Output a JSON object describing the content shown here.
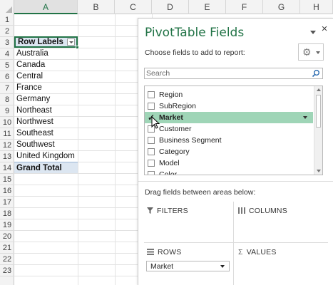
{
  "sheet": {
    "columns": [
      "A",
      "B",
      "C",
      "D",
      "E",
      "F",
      "G",
      "H"
    ],
    "selected_column": "A",
    "rows": [
      "1",
      "2",
      "3",
      "4",
      "5",
      "6",
      "7",
      "8",
      "9",
      "10",
      "11",
      "12",
      "13",
      "14",
      "15",
      "16",
      "17",
      "18",
      "19",
      "20",
      "21",
      "22",
      "23"
    ],
    "pivot": {
      "header": "Row Labels",
      "items": [
        "Australia",
        "Canada",
        "Central",
        "France",
        "Germany",
        "Northeast",
        "Northwest",
        "Southeast",
        "Southwest",
        "United Kingdom"
      ],
      "total": "Grand Total"
    }
  },
  "pane": {
    "title": "PivotTable Fields",
    "close_glyph": "×",
    "choose_text": "Choose fields to add to report:",
    "search_placeholder": "Search",
    "fields": [
      {
        "label": "Region",
        "checked": false
      },
      {
        "label": "SubRegion",
        "checked": false
      },
      {
        "label": "Market",
        "checked": true
      },
      {
        "label": "Customer",
        "checked": false
      },
      {
        "label": "Business Segment",
        "checked": false
      },
      {
        "label": "Category",
        "checked": false
      },
      {
        "label": "Model",
        "checked": false
      },
      {
        "label": "Color",
        "checked": false
      }
    ],
    "drag_text": "Drag fields between areas below:",
    "areas": {
      "filters": "FILTERS",
      "columns": "COLUMNS",
      "rows": "ROWS",
      "values": "VALUES",
      "values_symbol": "Σ"
    },
    "rows_field": "Market"
  },
  "colors": {
    "accent": "#217346",
    "highlight": "#9fd5b7",
    "pivot_fill": "#dce6f1"
  },
  "icons": [
    "filter-funnel-icon",
    "columns-icon",
    "rows-icon",
    "sigma-icon",
    "gear-icon",
    "search-icon",
    "close-icon",
    "checkmark-icon",
    "mouse-cursor-icon"
  ]
}
